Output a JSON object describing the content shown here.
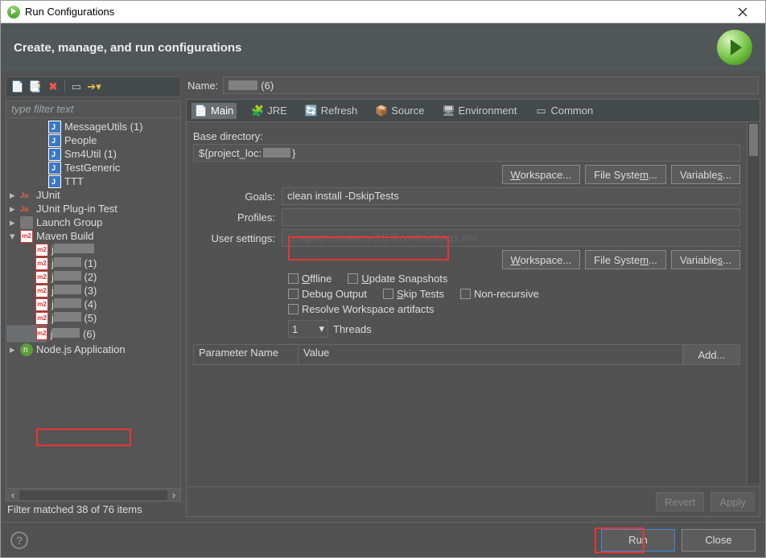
{
  "window": {
    "title": "Run Configurations"
  },
  "banner": {
    "title": "Create, manage, and run configurations"
  },
  "left": {
    "filter_placeholder": "type filter text",
    "status": "Filter matched 38 of 76 items",
    "tree": {
      "top_items": [
        {
          "label": "MessageUtils (1)",
          "icon": "j"
        },
        {
          "label": "People",
          "icon": "j"
        },
        {
          "label": "Sm4Util (1)",
          "icon": "j"
        },
        {
          "label": "TestGeneric",
          "icon": "j"
        },
        {
          "label": "TTT",
          "icon": "j"
        }
      ],
      "categories": [
        {
          "label": "JUnit",
          "icon": "ju"
        },
        {
          "label": "JUnit Plug-in Test",
          "icon": "ju"
        },
        {
          "label": "Launch Group",
          "icon": "grp"
        }
      ],
      "maven": {
        "label": "Maven Build",
        "children_suffixes": [
          "",
          "(1)",
          "(2)",
          "(3)",
          "(4)",
          "(5)",
          "(6)"
        ]
      },
      "node_label": "Node.js Application"
    }
  },
  "name": {
    "label": "Name:",
    "value_suffix": "(6)"
  },
  "tabs": [
    "Main",
    "JRE",
    "Refresh",
    "Source",
    "Environment",
    "Common"
  ],
  "form": {
    "base_dir_label": "Base directory:",
    "base_dir_value_prefix": "${project_loc:",
    "base_dir_value_suffix": "}",
    "goals_label": "Goals:",
    "goals_value": "clean install -DskipTests",
    "profiles_label": "Profiles:",
    "usersettings_label": "User settings:",
    "usersettings_hint": "D:\\apache-maven-3.5.3\\conf\\settings.xml",
    "buttons": {
      "workspace": "Workspace...",
      "filesystem": "File System...",
      "variables": "Variables..."
    },
    "checks": {
      "offline": "Offline",
      "update": "Update Snapshots",
      "debug": "Debug Output",
      "skip": "Skip Tests",
      "nonrec": "Non-recursive",
      "resolve": "Resolve Workspace artifacts"
    },
    "threads": {
      "value": "1",
      "label": "Threads"
    },
    "param_headers": {
      "name": "Parameter Name",
      "value": "Value",
      "add": "Add..."
    }
  },
  "bottom": {
    "revert": "Revert",
    "apply": "Apply"
  },
  "footer": {
    "run": "Run",
    "close": "Close"
  }
}
